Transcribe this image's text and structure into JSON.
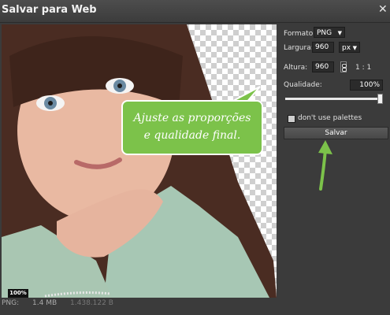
{
  "window": {
    "title": "Salvar para Web",
    "close_glyph": "✕"
  },
  "preview": {
    "zoom": "100%",
    "footer": {
      "format": "PNG:",
      "size": "1.4 MB",
      "bytes": "1.438.122 B"
    }
  },
  "callout": {
    "line1": "Ajuste as proporções",
    "line2": "e qualidade final."
  },
  "settings": {
    "format_label": "Formato:",
    "format_value": "PNG",
    "width_label": "Largura:",
    "width_value": "960",
    "unit_value": "px",
    "height_label": "Altura:",
    "height_value": "960",
    "ratio": "1 : 1",
    "quality_label": "Qualidade:",
    "quality_value": "100%",
    "quality_level": 1.0,
    "palette_label": "don't use palettes",
    "save_label": "Salvar"
  },
  "colors": {
    "accent": "#7cc24a",
    "background": "#3b3b3b"
  }
}
